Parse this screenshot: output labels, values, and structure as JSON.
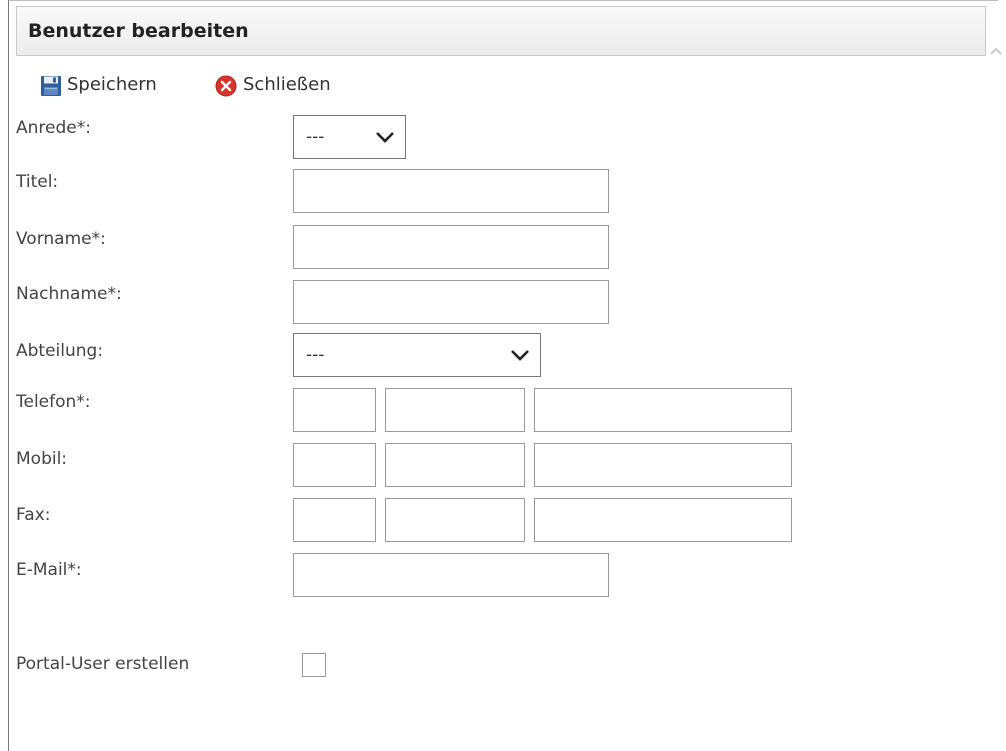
{
  "header": {
    "title": "Benutzer bearbeiten"
  },
  "toolbar": {
    "save_label": "Speichern",
    "save_icon": "floppy-disk-icon",
    "close_label": "Schließen",
    "close_icon": "close-circle-icon",
    "close_icon_color": "#d9342b"
  },
  "form": {
    "anrede": {
      "label": "Anrede*:",
      "value": "---"
    },
    "titel": {
      "label": "Titel:",
      "value": ""
    },
    "vorname": {
      "label": "Vorname*:",
      "value": ""
    },
    "nachname": {
      "label": "Nachname*:",
      "value": ""
    },
    "abteilung": {
      "label": "Abteilung:",
      "value": "---"
    },
    "telefon": {
      "label": "Telefon*:",
      "part1": "",
      "part2": "",
      "part3": ""
    },
    "mobil": {
      "label": "Mobil:",
      "part1": "",
      "part2": "",
      "part3": ""
    },
    "fax": {
      "label": "Fax:",
      "part1": "",
      "part2": "",
      "part3": ""
    },
    "email": {
      "label": "E-Mail*:",
      "value": ""
    },
    "portal_user": {
      "label": "Portal-User erstellen",
      "checked": false
    }
  }
}
